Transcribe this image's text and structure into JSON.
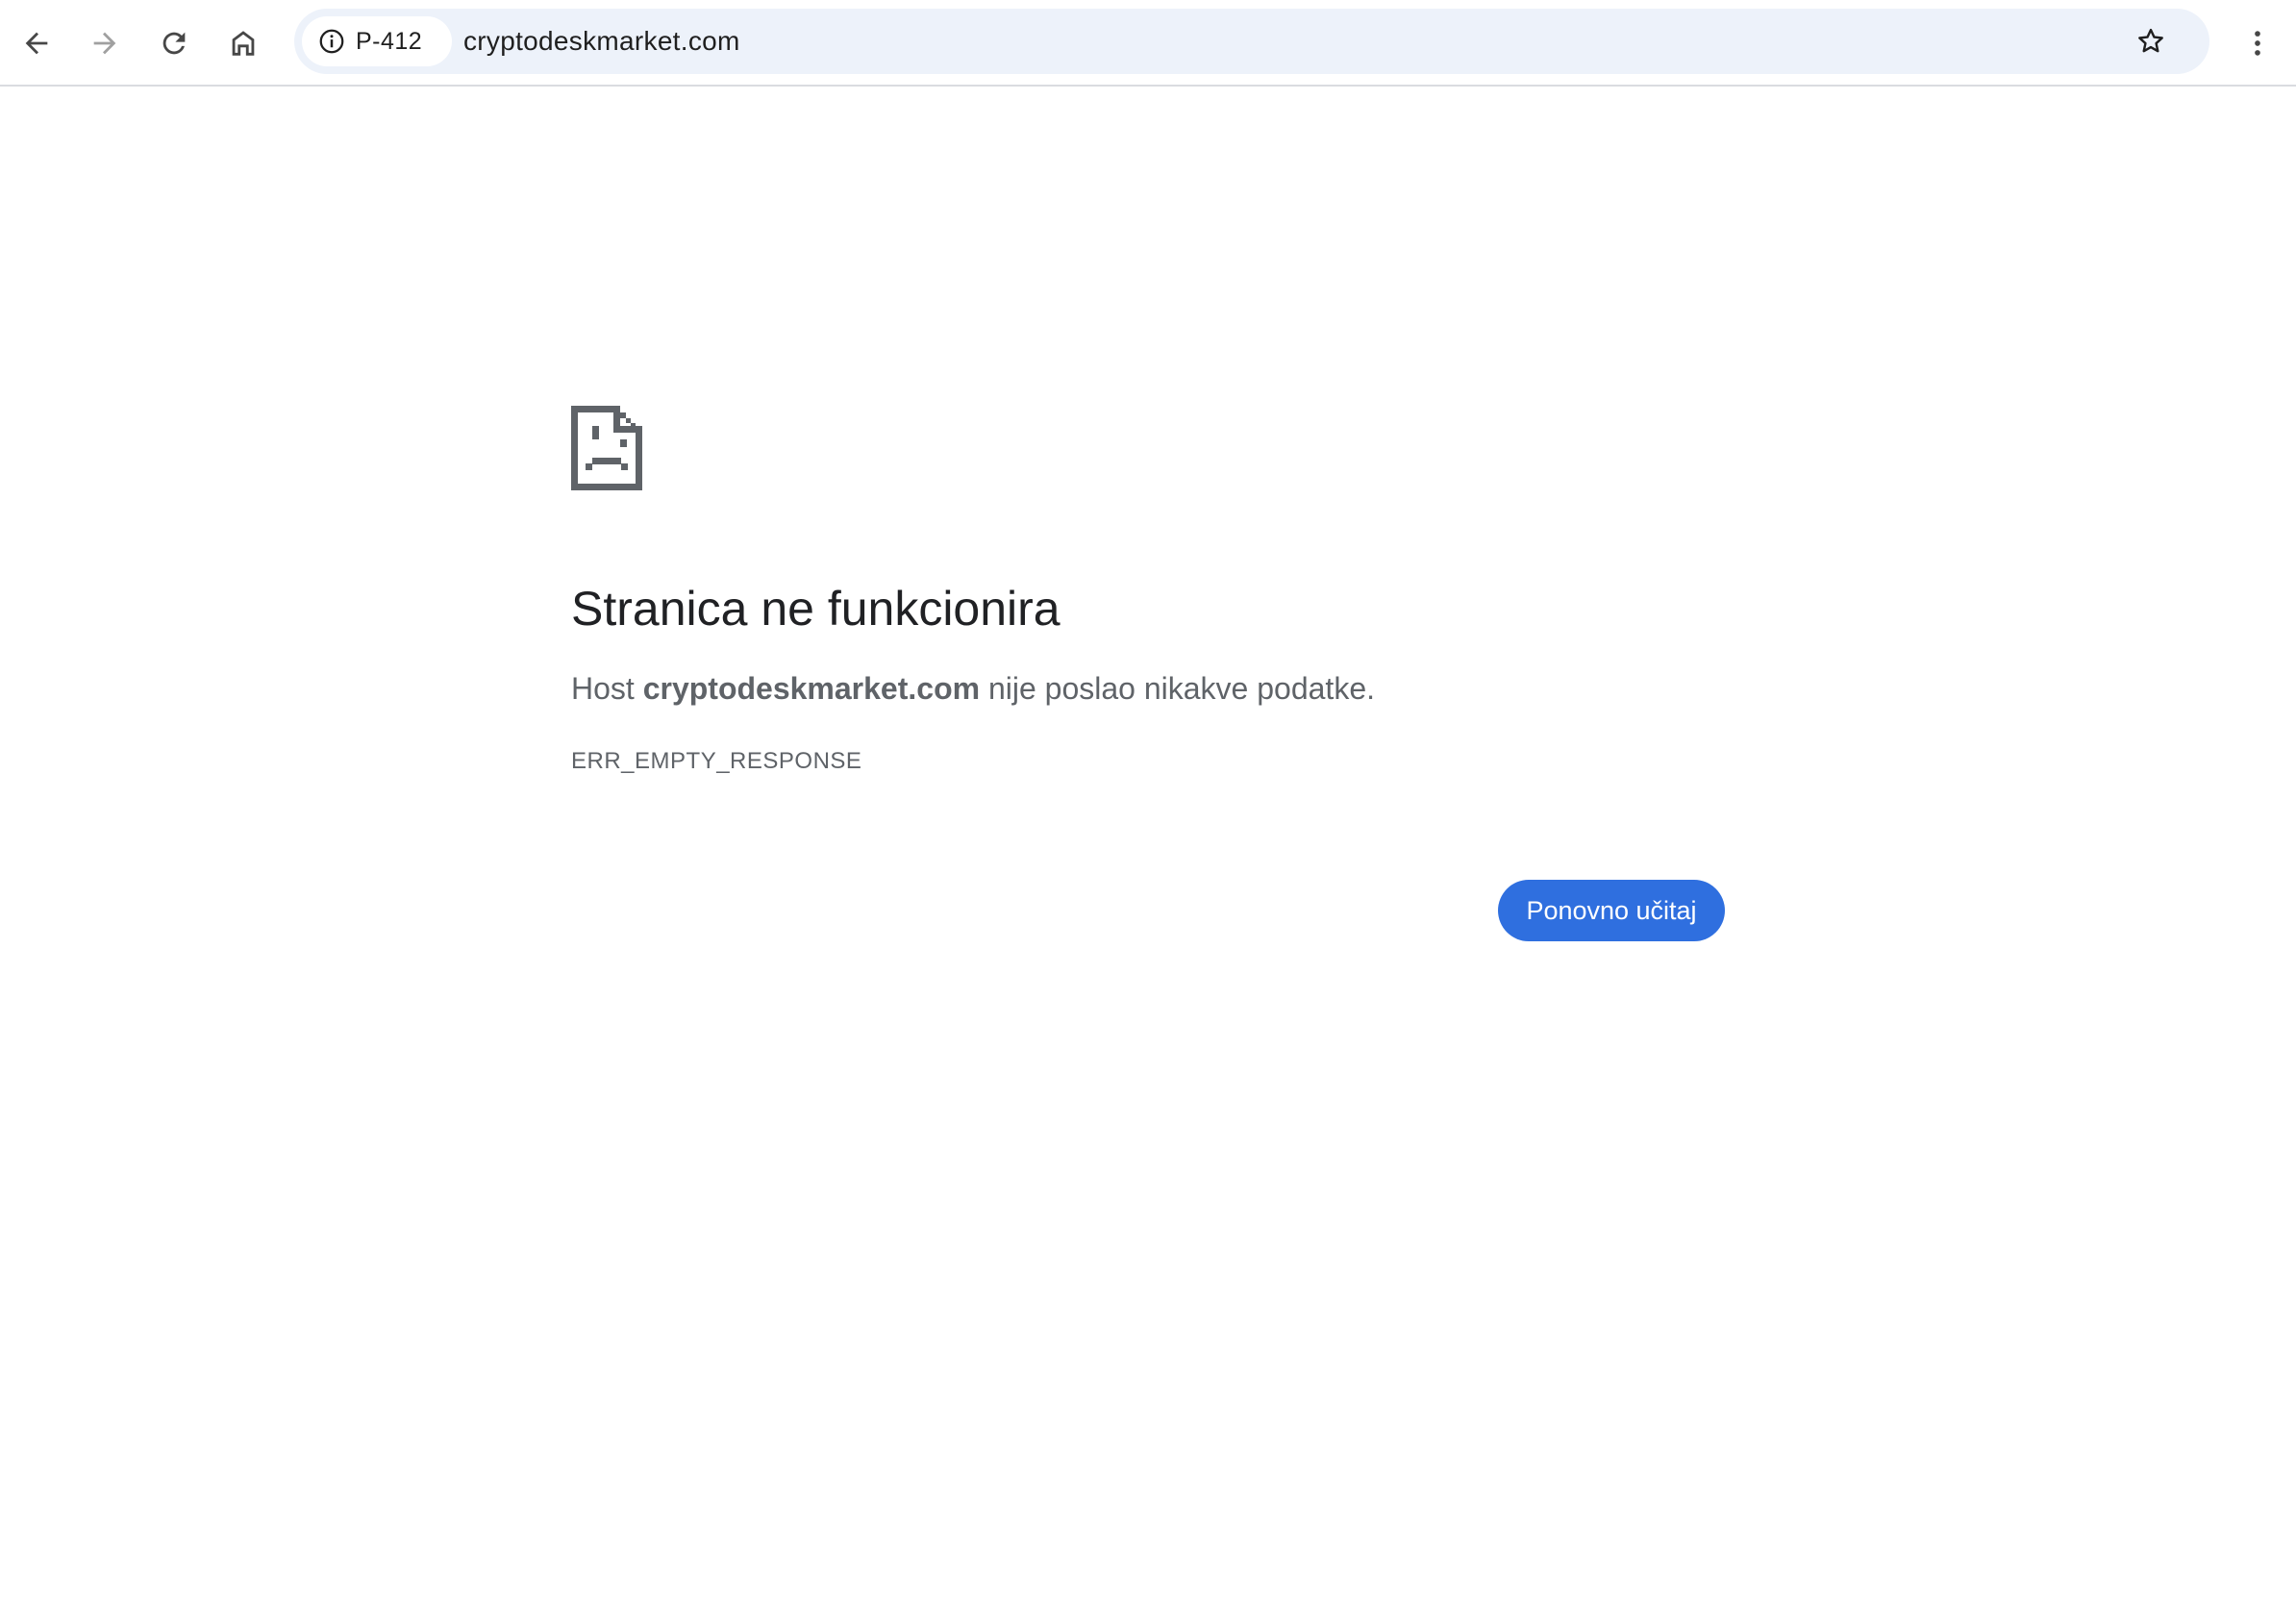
{
  "toolbar": {
    "site_chip_label": "P-412",
    "url": "cryptodeskmarket.com"
  },
  "error": {
    "title": "Stranica ne funkcionira",
    "desc_prefix": "Host ",
    "host": "cryptodeskmarket.com",
    "desc_suffix": " nije poslao nikakve podatke.",
    "code": "ERR_EMPTY_RESPONSE",
    "reload_label": "Ponovno učitaj"
  },
  "colors": {
    "accent_button": "#2f6fdf",
    "omnibox_bg": "#edf2fa",
    "icon_gray": "#5f6368"
  },
  "icons": {
    "back": "arrow-left-icon",
    "forward": "arrow-right-icon",
    "reload": "reload-icon",
    "home": "home-icon",
    "info": "info-icon",
    "bookmark": "star-icon",
    "menu": "kebab-menu-icon",
    "error": "sad-document-icon"
  }
}
